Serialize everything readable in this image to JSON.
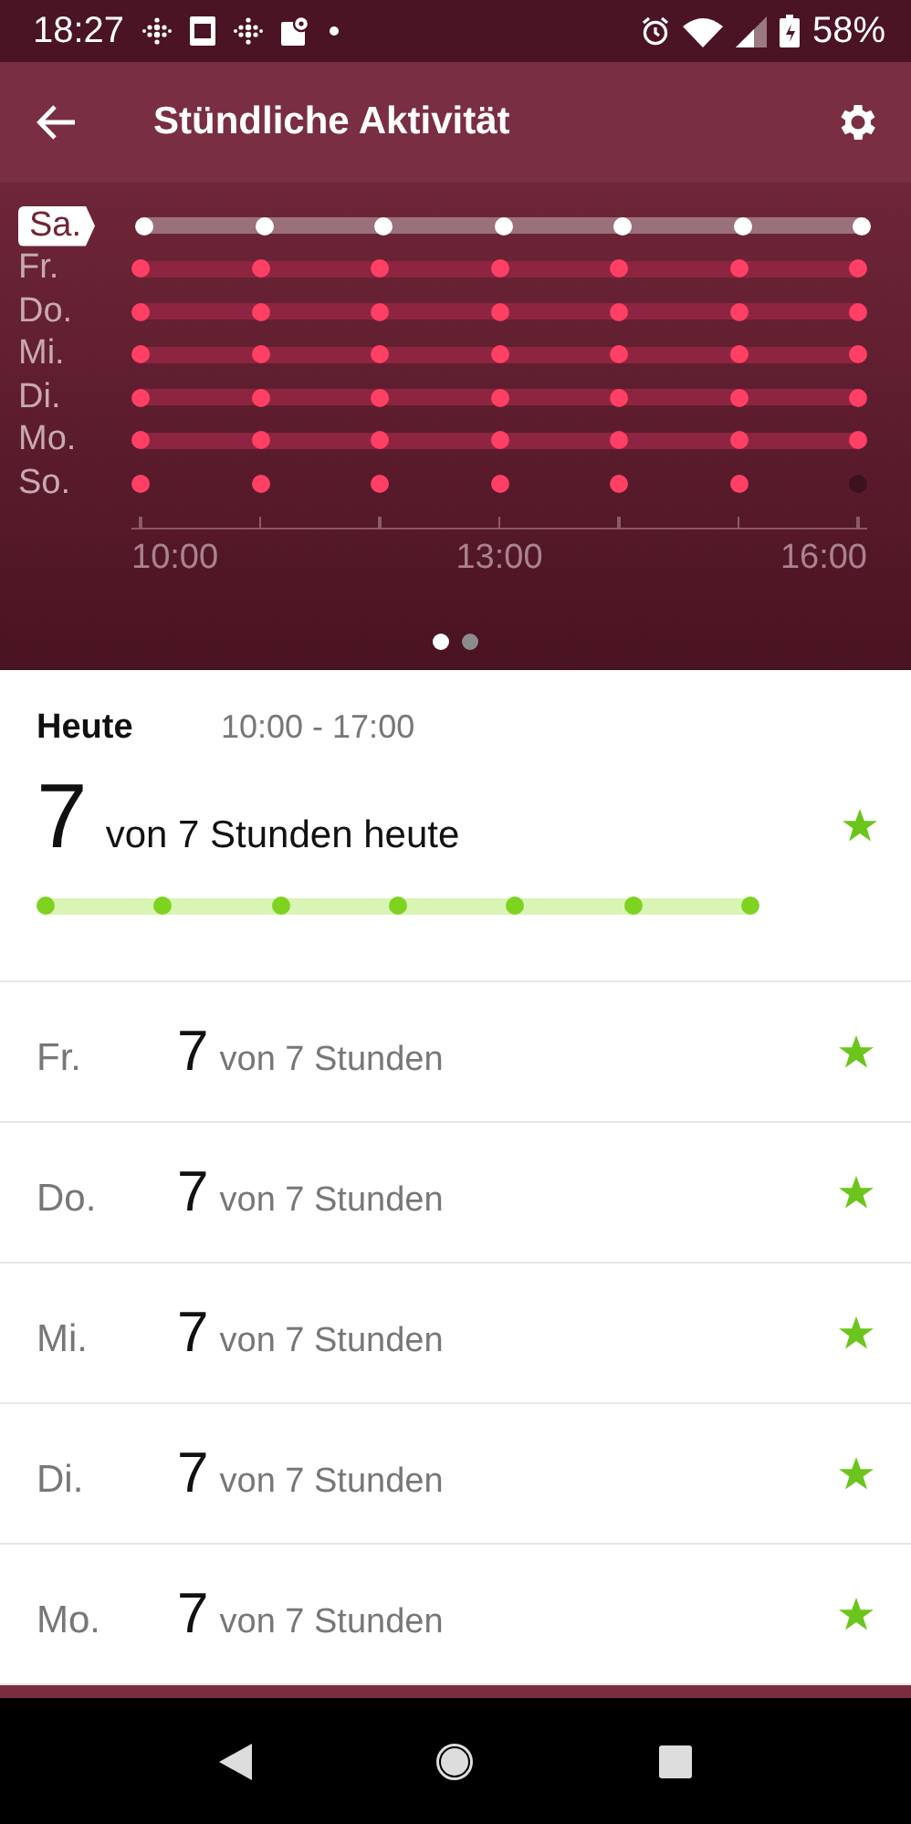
{
  "status_bar": {
    "time": "18:27",
    "battery": "58%"
  },
  "app_bar": {
    "title": "Stündliche Aktivität"
  },
  "week_chart": {
    "rows": [
      {
        "label": "Sa.",
        "selected": true,
        "bar": true,
        "hours": [
          true,
          true,
          true,
          true,
          true,
          true,
          true
        ]
      },
      {
        "label": "Fr.",
        "selected": false,
        "bar": true,
        "hours": [
          true,
          true,
          true,
          true,
          true,
          true,
          true
        ]
      },
      {
        "label": "Do.",
        "selected": false,
        "bar": true,
        "hours": [
          true,
          true,
          true,
          true,
          true,
          true,
          true
        ]
      },
      {
        "label": "Mi.",
        "selected": false,
        "bar": true,
        "hours": [
          true,
          true,
          true,
          true,
          true,
          true,
          true
        ]
      },
      {
        "label": "Di.",
        "selected": false,
        "bar": true,
        "hours": [
          true,
          true,
          true,
          true,
          true,
          true,
          true
        ]
      },
      {
        "label": "Mo.",
        "selected": false,
        "bar": true,
        "hours": [
          true,
          true,
          true,
          true,
          true,
          true,
          true
        ]
      },
      {
        "label": "So.",
        "selected": false,
        "bar": false,
        "hours": [
          true,
          true,
          true,
          true,
          true,
          true,
          false
        ]
      }
    ],
    "axis_labels": [
      "10:00",
      "13:00",
      "16:00"
    ],
    "pages": [
      {
        "selected": true
      },
      {
        "selected": false
      }
    ]
  },
  "today": {
    "title": "Heute",
    "range": "10:00 - 17:00",
    "count": "7",
    "summary": "von 7 Stunden heute",
    "goal_met": true,
    "hours": [
      true,
      true,
      true,
      true,
      true,
      true,
      true
    ]
  },
  "days": [
    {
      "label": "Fr.",
      "count": "7",
      "summary": "von 7 Stunden",
      "goal_met": true
    },
    {
      "label": "Do.",
      "count": "7",
      "summary": "von 7 Stunden",
      "goal_met": true
    },
    {
      "label": "Mi.",
      "count": "7",
      "summary": "von 7 Stunden",
      "goal_met": true
    },
    {
      "label": "Di.",
      "count": "7",
      "summary": "von 7 Stunden",
      "goal_met": true
    },
    {
      "label": "Mo.",
      "count": "7",
      "summary": "von 7 Stunden",
      "goal_met": true
    }
  ]
}
